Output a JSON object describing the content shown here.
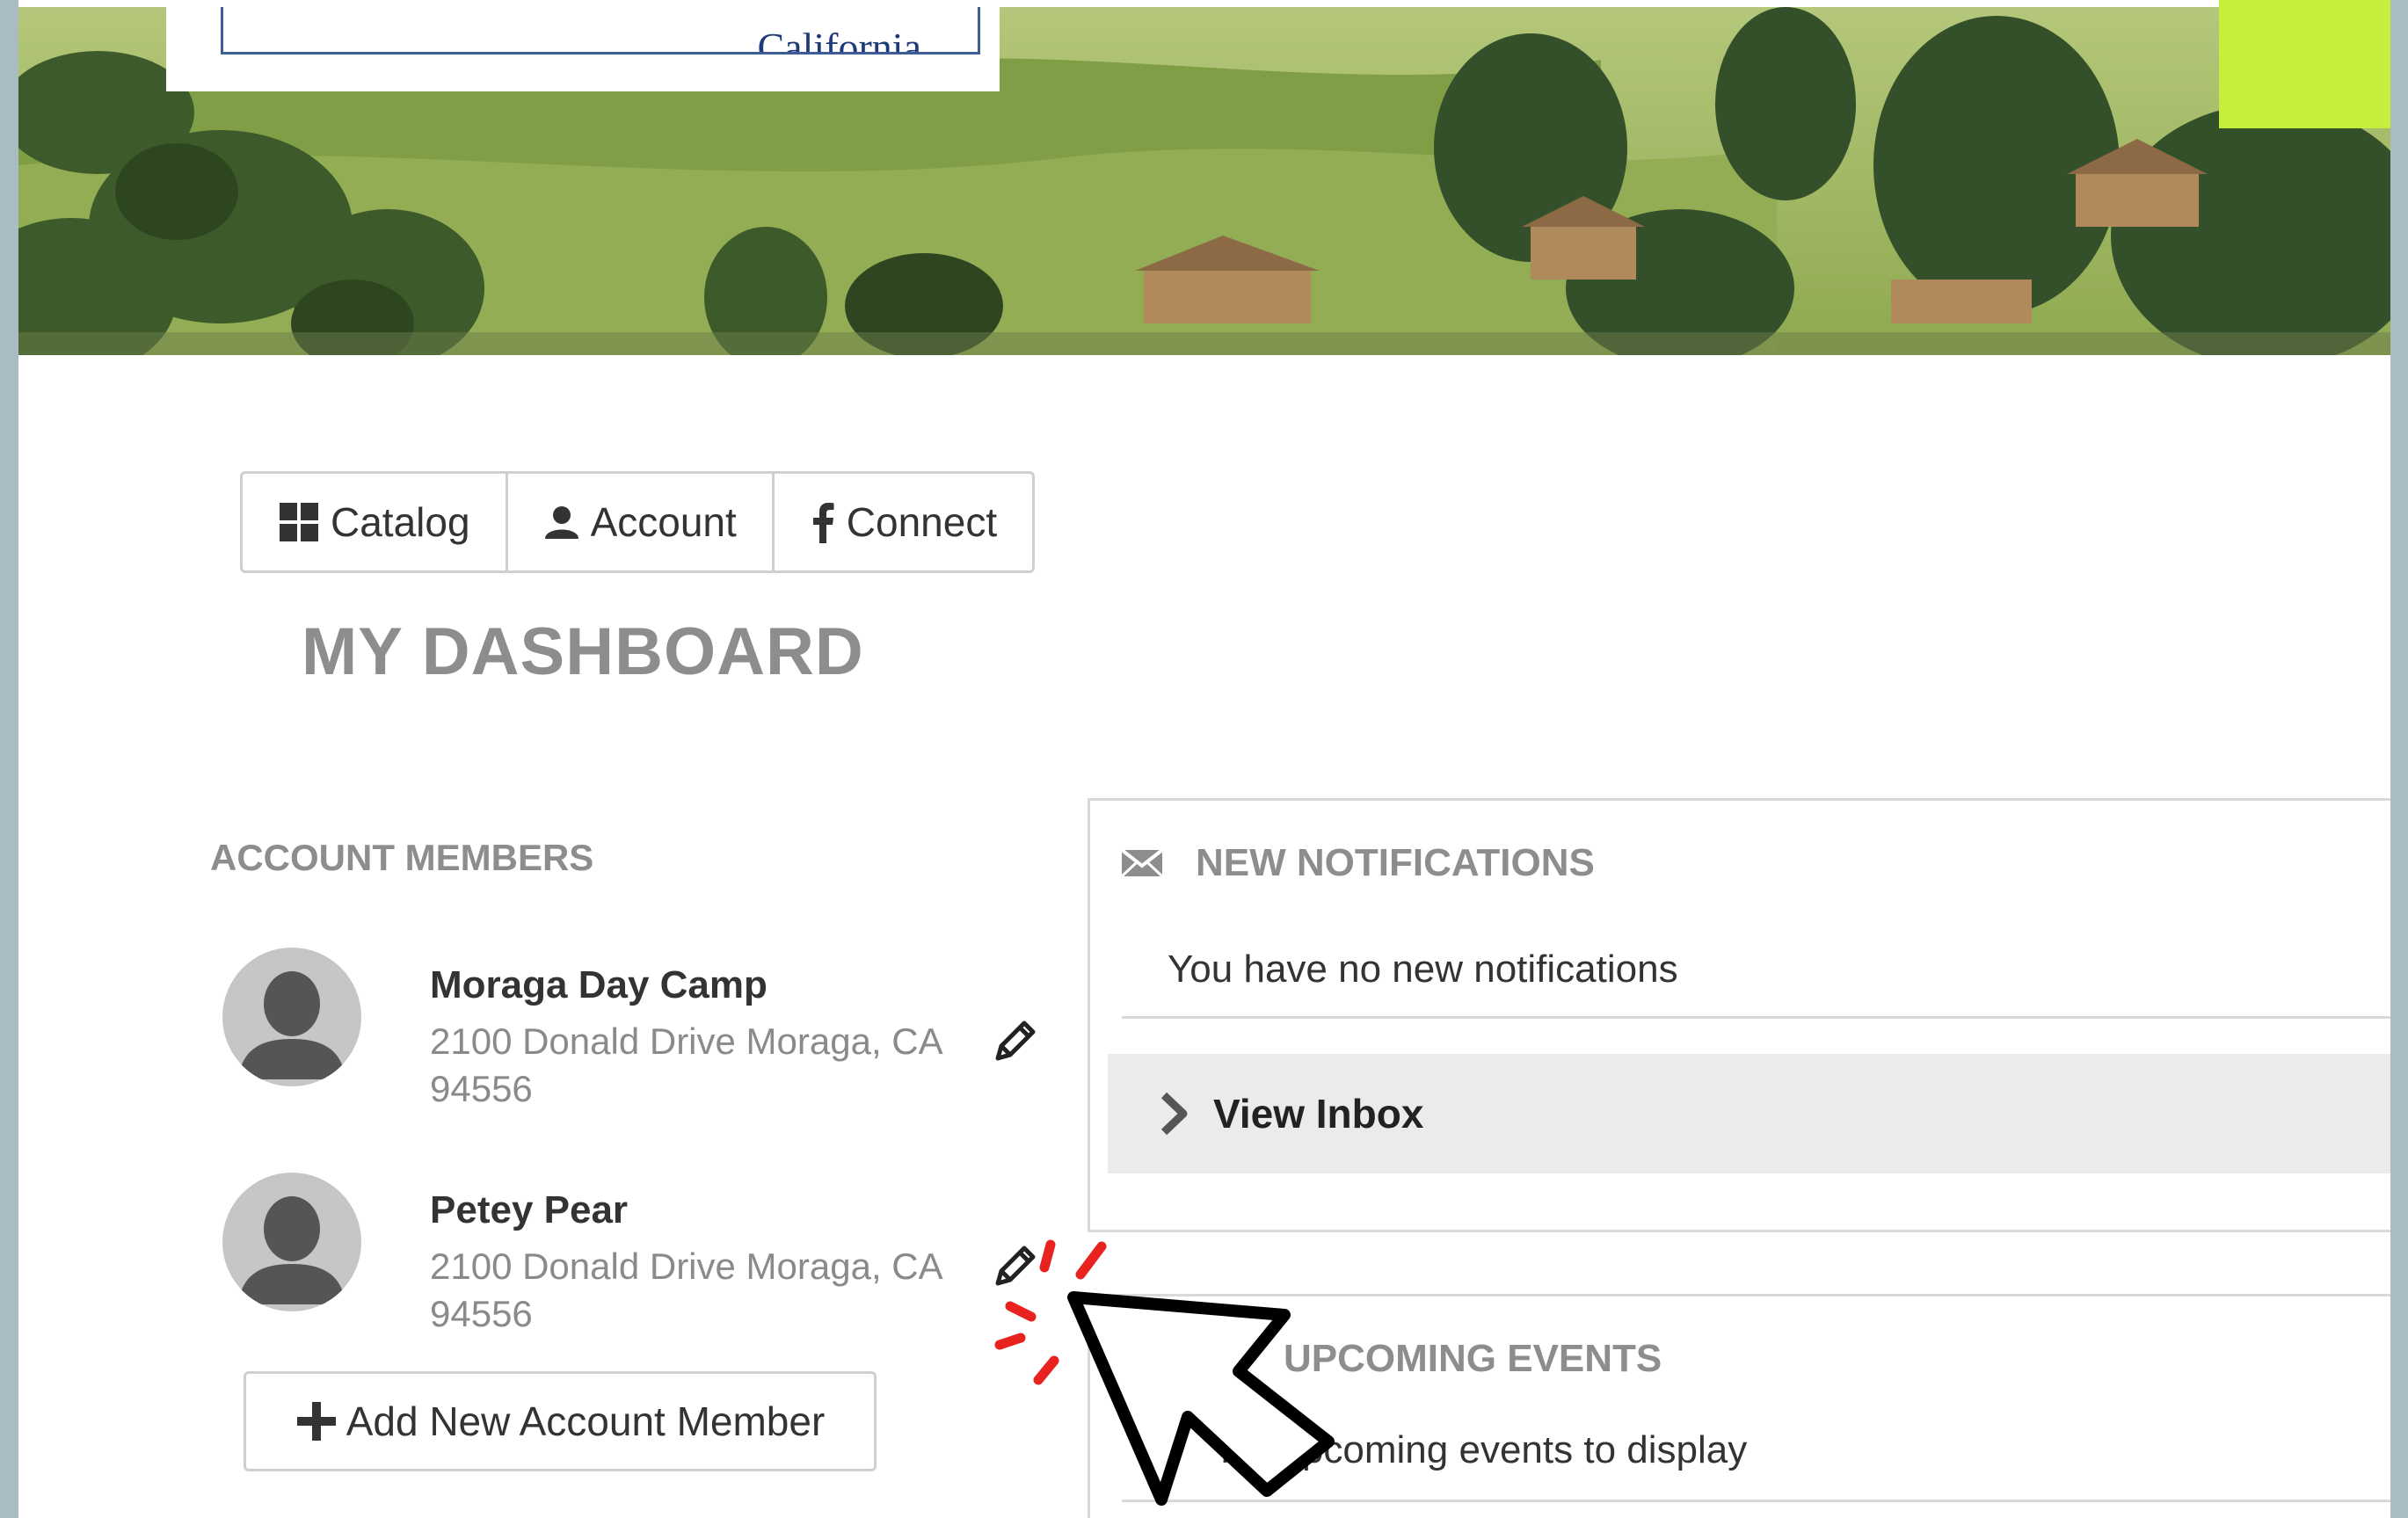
{
  "header": {
    "logo_text": "California"
  },
  "tabs": [
    {
      "label": "Catalog",
      "icon": "grid-icon"
    },
    {
      "label": "Account",
      "icon": "user-icon"
    },
    {
      "label": "Connect",
      "icon": "facebook-icon"
    }
  ],
  "dashboard": {
    "title": "MY DASHBOARD"
  },
  "account_members": {
    "heading": "ACCOUNT MEMBERS",
    "members": [
      {
        "name": "Moraga Day Camp",
        "address_line1": "2100 Donald Drive Moraga, CA",
        "address_line2": "94556"
      },
      {
        "name": "Petey Pear",
        "address_line1": "2100 Donald Drive Moraga, CA",
        "address_line2": "94556"
      }
    ],
    "add_button_label": "Add New Account Member"
  },
  "notifications": {
    "heading": "NEW NOTIFICATIONS",
    "empty_text": "You have no new notifications",
    "inbox_label": "View Inbox"
  },
  "events": {
    "heading": "UPCOMING EVENTS",
    "empty_text": "No upcoming events to display"
  },
  "colors": {
    "outer_frame": "#a9bcc4",
    "lime_accent": "#c6ef3d",
    "heading_gray": "#8d8d8d",
    "click_marker": "#e8231f"
  }
}
